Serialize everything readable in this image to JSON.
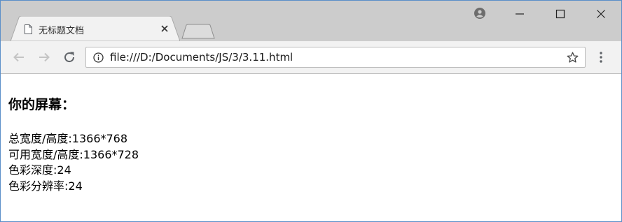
{
  "browser": {
    "tab": {
      "title": "无标题文档"
    },
    "address_bar": {
      "url": "file:///D:/Documents/JS/3/3.11.html"
    },
    "icons": {
      "tab_doc": "document-icon",
      "tab_close": "close-icon",
      "new_tab": "new-tab-icon",
      "profile": "profile-icon",
      "minimize": "minimize-icon",
      "maximize": "maximize-icon",
      "close": "close-icon",
      "back": "back-arrow-icon",
      "forward": "forward-arrow-icon",
      "reload": "reload-icon",
      "info": "info-icon",
      "bookmark": "star-icon",
      "menu": "kebab-menu-icon"
    },
    "colors": {
      "tabstrip": "#cccccc",
      "toolbar": "#f2f2f2",
      "window_border": "#5a8ec8"
    }
  },
  "page": {
    "heading": "你的屏幕：",
    "lines": [
      "总宽度/高度:1366*768",
      "可用宽度/高度:1366*728",
      "色彩深度:24",
      "色彩分辨率:24"
    ]
  }
}
